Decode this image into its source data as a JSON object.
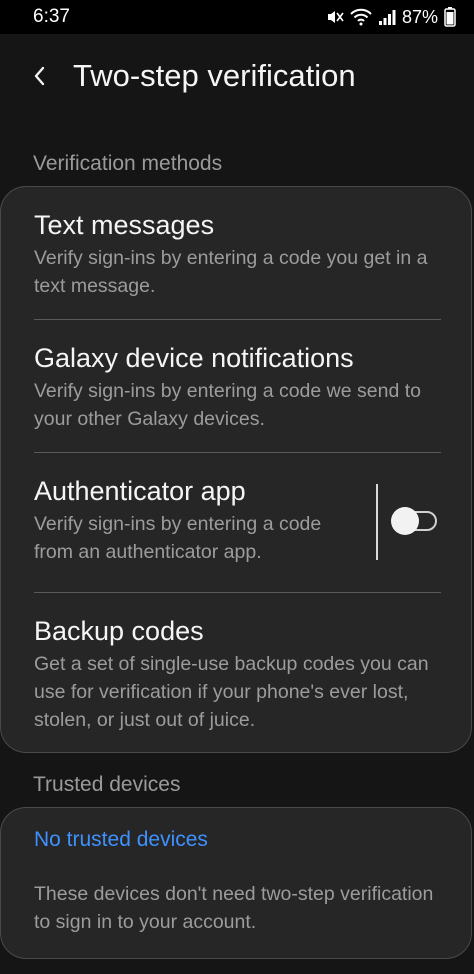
{
  "status_bar": {
    "time": "6:37",
    "battery_percent": "87%",
    "icons": [
      "mute-icon",
      "wifi-icon",
      "signal-icon",
      "battery-icon"
    ]
  },
  "header": {
    "back_icon": "chevron-left-icon",
    "title": "Two-step verification"
  },
  "verification_methods": {
    "section_title": "Verification methods",
    "items": [
      {
        "title": "Text messages",
        "description": "Verify sign-ins by entering a code you get in a text message."
      },
      {
        "title": "Galaxy device notifications",
        "description": "Verify sign-ins by entering a code we send to your other Galaxy devices."
      },
      {
        "title": "Authenticator app",
        "description": "Verify sign-ins by entering a code from an authenticator app.",
        "toggle_on": false
      },
      {
        "title": "Backup codes",
        "description": "Get a set of single-use backup codes you can use for verification if your phone's ever lost, stolen, or just out of juice."
      }
    ]
  },
  "trusted_devices": {
    "section_title": "Trusted devices",
    "link": "No trusted devices",
    "description": "These devices don't need two-step verification to sign in to your account."
  },
  "colors": {
    "background": "#151515",
    "card": "#262626",
    "link": "#3e91ff",
    "secondary_text": "#9c9c9c"
  }
}
